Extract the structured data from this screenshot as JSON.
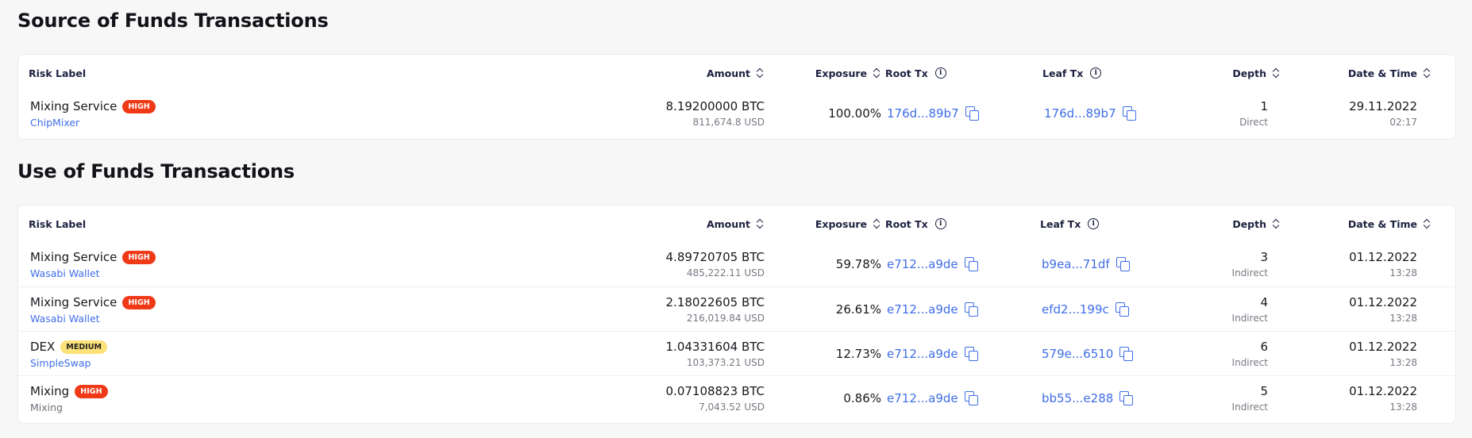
{
  "source": {
    "title": "Source of Funds Transactions",
    "headers": {
      "risk_label": "Risk Label",
      "amount": "Amount",
      "exposure": "Exposure",
      "root_tx": "Root Tx",
      "leaf_tx": "Leaf Tx",
      "depth": "Depth",
      "date_time": "Date & Time"
    },
    "rows": [
      {
        "label": "Mixing Service",
        "risk": "HIGH",
        "entity": "ChipMixer",
        "btc": "8.19200000 BTC",
        "usd": "811,674.8 USD",
        "exposure": "100.00%",
        "root_tx": "176d...89b7",
        "leaf_tx": "176d...89b7",
        "depth": "1",
        "depth_type": "Direct",
        "date": "29.11.2022",
        "time": "02:17"
      }
    ]
  },
  "use": {
    "title": "Use of Funds Transactions",
    "headers": {
      "risk_label": "Risk Label",
      "amount": "Amount",
      "exposure": "Exposure",
      "root_tx": "Root Tx",
      "leaf_tx": "Leaf Tx",
      "depth": "Depth",
      "date_time": "Date & Time"
    },
    "rows": [
      {
        "label": "Mixing Service",
        "risk": "HIGH",
        "entity": "Wasabi Wallet",
        "btc": "4.89720705 BTC",
        "usd": "485,222.11 USD",
        "exposure": "59.78%",
        "root_tx": "e712...a9de",
        "leaf_tx": "b9ea...71df",
        "depth": "3",
        "depth_type": "Indirect",
        "date": "01.12.2022",
        "time": "13:28"
      },
      {
        "label": "Mixing Service",
        "risk": "HIGH",
        "entity": "Wasabi Wallet",
        "btc": "2.18022605 BTC",
        "usd": "216,019.84 USD",
        "exposure": "26.61%",
        "root_tx": "e712...a9de",
        "leaf_tx": "efd2...199c",
        "depth": "4",
        "depth_type": "Indirect",
        "date": "01.12.2022",
        "time": "13:28"
      },
      {
        "label": "DEX",
        "risk": "MEDIUM",
        "entity": "SimpleSwap",
        "btc": "1.04331604 BTC",
        "usd": "103,373.21 USD",
        "exposure": "12.73%",
        "root_tx": "e712...a9de",
        "leaf_tx": "579e...6510",
        "depth": "6",
        "depth_type": "Indirect",
        "date": "01.12.2022",
        "time": "13:28"
      },
      {
        "label": "Mixing",
        "risk": "HIGH",
        "entity": "Mixing",
        "btc": "0.07108823 BTC",
        "usd": "7,043.52 USD",
        "exposure": "0.86%",
        "root_tx": "e712...a9de",
        "leaf_tx": "bb55...e288",
        "depth": "5",
        "depth_type": "Indirect",
        "date": "01.12.2022",
        "time": "13:28"
      }
    ]
  },
  "colors": {
    "high": "#f03a17",
    "medium": "#fde27a",
    "link": "#3f6ee8"
  },
  "icons": {
    "sort": "sort-icon",
    "info": "info-icon",
    "copy": "copy-icon"
  }
}
